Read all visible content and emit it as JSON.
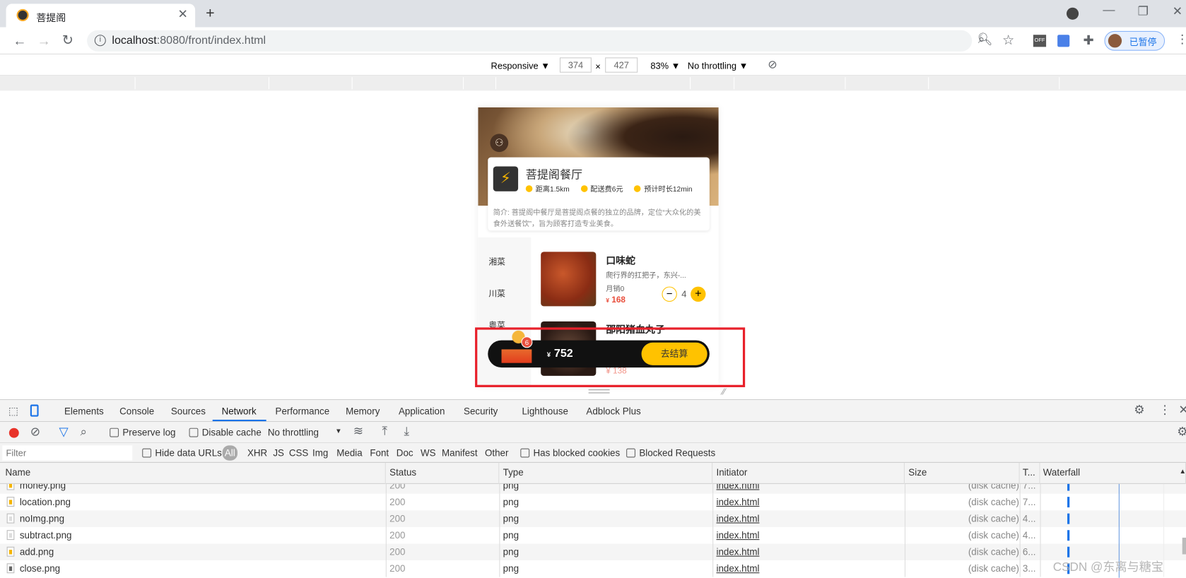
{
  "browser": {
    "tab_title": "菩提阁",
    "url_host": "localhost",
    "url_rest": ":8080/front/index.html",
    "profile_label": "已暂停"
  },
  "device_toolbar": {
    "mode": "Responsive ▼",
    "width": "374",
    "times": "×",
    "height": "427",
    "zoom": "83% ▼",
    "throttle": "No throttling ▼"
  },
  "page": {
    "restaurant_name": "菩提阁餐厅",
    "info": [
      "距离1.5km",
      "配送费6元",
      "预计时长12min"
    ],
    "intro": "简介: 菩提阁中餐厅是菩提阁点餐的独立的品牌，定位“大众化的美食外送餐饮”，旨为顾客打造专业美食。",
    "categories": [
      "湘菜",
      "川菜",
      "粤菜"
    ],
    "dish": {
      "name": "口味蛇",
      "desc": "爬行界的扛把子，东兴-...",
      "sales": "月销0",
      "price": "168",
      "currency": "¥",
      "qty": "4"
    },
    "dish2": {
      "name": "邵阳猪血丸子",
      "price": "¥ 138"
    },
    "cart": {
      "badge": "6",
      "currency": "¥",
      "total": "752",
      "checkout": "去结算"
    },
    "accent": "#ffc200",
    "price_color": "#e94e3c"
  },
  "devtools": {
    "tabs": [
      "Elements",
      "Console",
      "Sources",
      "Network",
      "Performance",
      "Memory",
      "Application",
      "Security",
      "Lighthouse",
      "Adblock Plus"
    ],
    "active_tab": "Network",
    "toolbar": {
      "preserve_log": "Preserve log",
      "disable_cache": "Disable cache",
      "throttle": "No throttling"
    },
    "filter": {
      "placeholder": "Filter",
      "hide_data_urls": "Hide data URLs",
      "types": [
        "All",
        "XHR",
        "JS",
        "CSS",
        "Img",
        "Media",
        "Font",
        "Doc",
        "WS",
        "Manifest",
        "Other"
      ],
      "blocked_cookies": "Has blocked cookies",
      "blocked_requests": "Blocked Requests"
    },
    "columns": [
      "Name",
      "Status",
      "Type",
      "Initiator",
      "Size",
      "T...",
      "Waterfall"
    ],
    "rows": [
      {
        "name": "money.png",
        "status": "200",
        "type": "png",
        "initiator": "index.html",
        "size": "(disk cache)",
        "time": "7..."
      },
      {
        "name": "location.png",
        "status": "200",
        "type": "png",
        "initiator": "index.html",
        "size": "(disk cache)",
        "time": "7..."
      },
      {
        "name": "noImg.png",
        "status": "200",
        "type": "png",
        "initiator": "index.html",
        "size": "(disk cache)",
        "time": "4..."
      },
      {
        "name": "subtract.png",
        "status": "200",
        "type": "png",
        "initiator": "index.html",
        "size": "(disk cache)",
        "time": "4..."
      },
      {
        "name": "add.png",
        "status": "200",
        "type": "png",
        "initiator": "index.html",
        "size": "(disk cache)",
        "time": "6..."
      },
      {
        "name": "close.png",
        "status": "200",
        "type": "png",
        "initiator": "index.html",
        "size": "(disk cache)",
        "time": "3..."
      }
    ]
  },
  "watermark": "CSDN @东离与糖宝"
}
